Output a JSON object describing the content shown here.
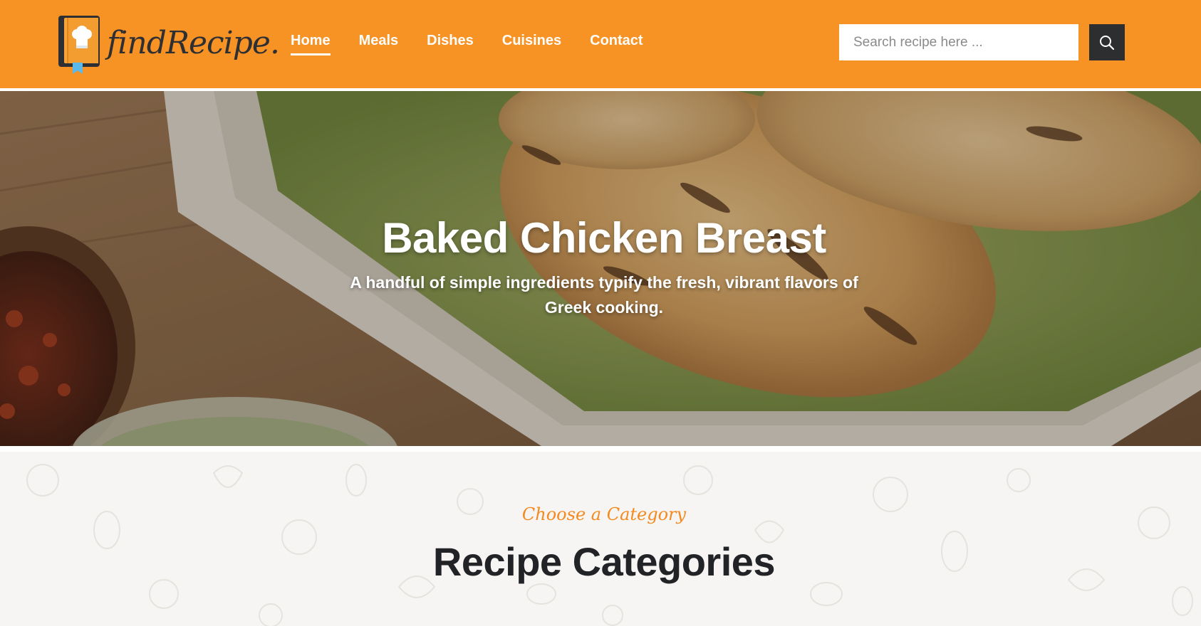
{
  "brand": {
    "name": "findRecipe.",
    "primary_color": "#f79324",
    "dark_color": "#2d2e30",
    "logo_icon": "chef-hat-book-icon"
  },
  "nav": {
    "items": [
      {
        "label": "Home",
        "active": true
      },
      {
        "label": "Meals",
        "active": false
      },
      {
        "label": "Dishes",
        "active": false
      },
      {
        "label": "Cuisines",
        "active": false
      },
      {
        "label": "Contact",
        "active": false
      }
    ]
  },
  "search": {
    "placeholder": "Search recipe here ...",
    "value": "",
    "button_icon": "search-icon"
  },
  "hero": {
    "title": "Baked Chicken Breast",
    "subtitle": "A handful of simple ingredients typify the fresh, vibrant flavors of Greek cooking.",
    "image": "baked-chicken-breast-photo"
  },
  "categories": {
    "eyebrow": "Choose a Category",
    "title": "Recipe Categories"
  }
}
